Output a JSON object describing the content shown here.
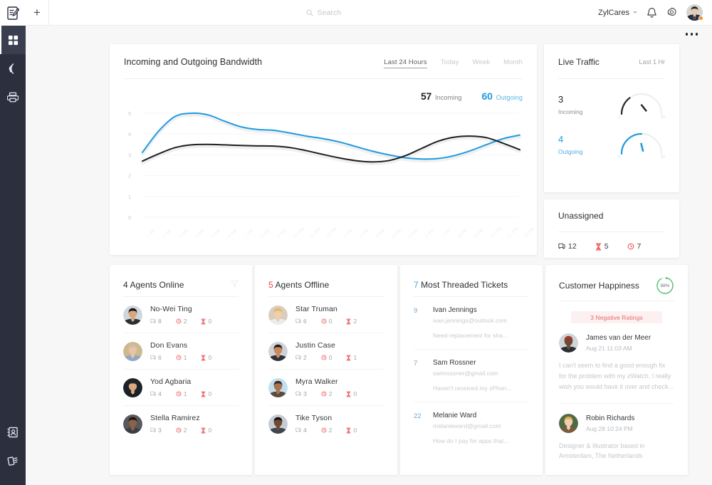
{
  "sidebar": {
    "logo_icon": "pen-document-logo",
    "items": [
      {
        "icon": "grid-dashboard-icon",
        "name": "dashboard",
        "active": true
      },
      {
        "icon": "signal-broadcast-icon",
        "name": "broadcast",
        "active": false
      },
      {
        "icon": "printer-inbox-icon",
        "name": "inbox",
        "active": false
      }
    ],
    "bottom_items": [
      {
        "icon": "contact-card-icon",
        "name": "contacts",
        "active": false
      },
      {
        "icon": "notes-list-icon",
        "name": "notes",
        "active": false
      }
    ]
  },
  "topbar": {
    "add_label": "+",
    "search": {
      "placeholder": "Search",
      "value": "",
      "icon": "search-icon"
    },
    "org_name": "ZylCares",
    "notifications_icon": "bell-icon",
    "settings_icon": "gear-icon",
    "avatar_icon": "user-avatar",
    "status_color": "#ff8c1a",
    "overflow_icon": "more-horizontal-icon"
  },
  "bandwidth": {
    "title": "Incoming and Outgoing Bandwidth",
    "tabs": [
      {
        "label": "Last 24 Hours",
        "active": true
      },
      {
        "label": "Today",
        "active": false
      },
      {
        "label": "Week",
        "active": false
      },
      {
        "label": "Month",
        "active": false
      }
    ],
    "incoming_value": "57",
    "incoming_label": "Incoming",
    "outgoing_value": "60",
    "outgoing_label": "Outgoing"
  },
  "chart_data": {
    "type": "line",
    "title": "Incoming and Outgoing Bandwidth",
    "xlabel": "",
    "ylabel": "",
    "ylim": [
      0,
      5
    ],
    "yticks": [
      "0",
      "1",
      "2",
      "3",
      "4",
      "5"
    ],
    "grid": true,
    "legend": "top-right",
    "x": [
      "1 AM",
      "2 AM",
      "3 AM",
      "4 AM",
      "5 AM",
      "6 AM",
      "7 AM",
      "8 AM",
      "9 AM",
      "10 AM",
      "11 AM",
      "12 PM",
      "1 PM",
      "2 PM",
      "3 PM",
      "4 PM",
      "5 PM",
      "6 PM",
      "7 PM",
      "8 PM",
      "9 PM",
      "10 PM",
      "11 PM",
      "12 AM"
    ],
    "series": [
      {
        "name": "Outgoing",
        "color": "#1f9bde",
        "values": [
          3.12,
          4.15,
          4.85,
          5.0,
          4.92,
          4.62,
          4.35,
          4.22,
          4.18,
          4.05,
          3.9,
          3.78,
          3.62,
          3.4,
          3.18,
          3.0,
          2.86,
          2.8,
          2.82,
          2.96,
          3.2,
          3.5,
          3.78,
          3.95
        ]
      },
      {
        "name": "Incoming",
        "color": "#1c1f24",
        "values": [
          2.7,
          3.05,
          3.35,
          3.48,
          3.5,
          3.48,
          3.45,
          3.43,
          3.42,
          3.35,
          3.2,
          3.02,
          2.85,
          2.72,
          2.66,
          2.72,
          2.95,
          3.3,
          3.65,
          3.85,
          3.9,
          3.82,
          3.55,
          3.25
        ]
      }
    ]
  },
  "live_traffic": {
    "title": "Live Traffic",
    "range": "Last 1 Hr",
    "rows": [
      {
        "value": "3",
        "label": "Incoming",
        "color": "#23262b",
        "gauge_min": "0",
        "gauge_max": "10",
        "gauge_value": 3
      },
      {
        "value": "4",
        "label": "Outgoing",
        "color": "#1f9bde",
        "gauge_min": "0",
        "gauge_max": "10",
        "gauge_value": 4
      }
    ]
  },
  "unassigned": {
    "title": "Unassigned",
    "stats": [
      {
        "icon": "chat-bubble-icon",
        "value": "12",
        "color": "#33373c"
      },
      {
        "icon": "hourglass-icon",
        "value": "5",
        "color": "#ec4245"
      },
      {
        "icon": "clock-alert-icon",
        "value": "7",
        "color": "#ec4245"
      }
    ]
  },
  "agents_online": {
    "count": "4",
    "title": "Agents Online",
    "filter_icon": "filter-funnel-icon",
    "agents": [
      {
        "name": "No-Wei Ting",
        "threads": "8",
        "pending": "2",
        "overdue": "0",
        "avatar": "a1"
      },
      {
        "name": "Don Evans",
        "threads": "6",
        "pending": "1",
        "overdue": "0",
        "avatar": "a2"
      },
      {
        "name": "Yod Agbaria",
        "threads": "4",
        "pending": "1",
        "overdue": "0",
        "avatar": "a3"
      },
      {
        "name": "Stella Ramirez",
        "threads": "3",
        "pending": "2",
        "overdue": "0",
        "avatar": "a4"
      }
    ]
  },
  "agents_offline": {
    "count": "5",
    "title": "Agents Offline",
    "agents": [
      {
        "name": "Star Truman",
        "threads": "6",
        "pending": "0",
        "overdue": "2",
        "avatar": "b1"
      },
      {
        "name": "Justin Case",
        "threads": "2",
        "pending": "0",
        "overdue": "1",
        "avatar": "b2"
      },
      {
        "name": "Myra Walker",
        "threads": "3",
        "pending": "2",
        "overdue": "0",
        "avatar": "b3"
      },
      {
        "name": "Tike Tyson",
        "threads": "4",
        "pending": "2",
        "overdue": "0",
        "avatar": "b4"
      }
    ]
  },
  "threaded_tickets": {
    "count": "7",
    "title": "Most Threaded Tickets",
    "tickets": [
      {
        "count": "9",
        "name": "Ivan Jennings",
        "email": "ivan.jennings@outlook.com",
        "message": "Need replacement for sha..."
      },
      {
        "count": "7",
        "name": "Sam Rossner",
        "email": "samrossner@gmail.com",
        "message": "Haven't received my zPhon..."
      },
      {
        "count": "22",
        "name": "Melanie Ward",
        "email": "melanieward@gmail.com",
        "message": "How do I pay for apps that..."
      }
    ]
  },
  "customer_happiness": {
    "title": "Customer Happiness",
    "score": "88%",
    "score_value": 88,
    "score_color": "#5ec27e",
    "negative_badge": "3 Negative Ratings",
    "reviews": [
      {
        "name": "James van der Meer",
        "date": "Aug 21 11:03 AM",
        "body": "I can't seem to find a good enough fix for the problem with my zWatch. I really wish you would have it over and check...",
        "avatar": "c1"
      },
      {
        "name": "Robin Richards",
        "date": "Aug 28 10:24 PM",
        "body": "Designer & Illustrator based in Amsterdam, The Netherlands",
        "avatar": "c2"
      }
    ]
  }
}
